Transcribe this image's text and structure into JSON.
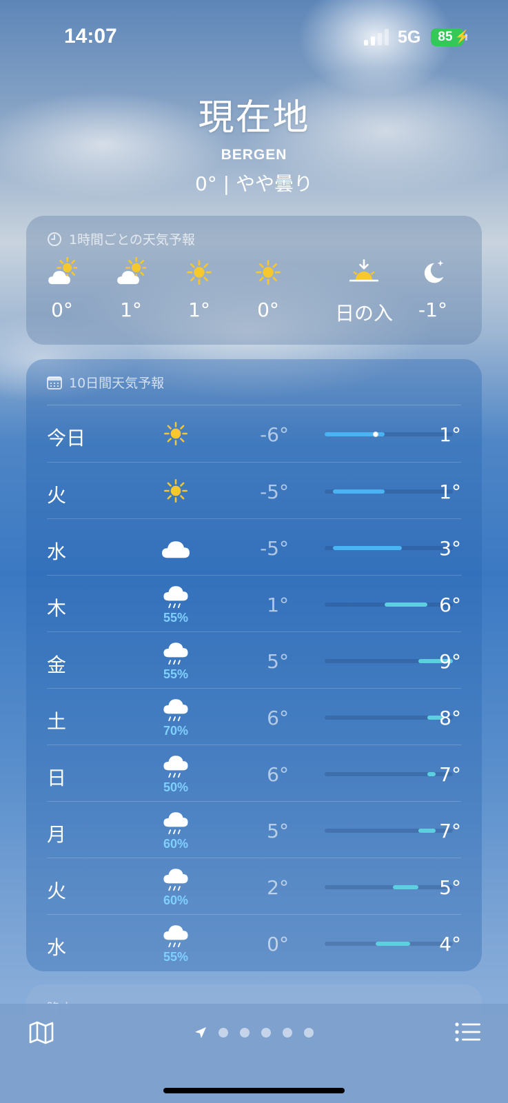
{
  "status_bar": {
    "time": "14:07",
    "network": "5G",
    "battery": "85"
  },
  "header": {
    "location": "現在地",
    "city": "BERGEN",
    "current": "0° | やや曇り"
  },
  "hourly": {
    "title": "1時間ごとの天気予報",
    "items": [
      {
        "icon": "partly-sunny-icon",
        "temp": "0°"
      },
      {
        "icon": "partly-sunny-icon",
        "temp": "1°"
      },
      {
        "icon": "sun-icon",
        "temp": "1°"
      },
      {
        "icon": "sun-icon",
        "temp": "0°"
      },
      {
        "icon": "sunset-icon",
        "temp": "日の入"
      },
      {
        "icon": "moon-stars-icon",
        "temp": "-1°"
      }
    ]
  },
  "daily": {
    "title": "10日間天気予報",
    "range_min": -6,
    "range_max": 9,
    "current_temp": 0,
    "colors": {
      "cold": "#4ab3f4",
      "mild": "#5dd0e0",
      "track": "#2e5a94"
    },
    "rows": [
      {
        "day": "今日",
        "icon": "sun-icon",
        "pct": "",
        "low": "-6°",
        "high": "1°",
        "low_val": -6,
        "high_val": 1,
        "now": true
      },
      {
        "day": "火",
        "icon": "sun-icon",
        "pct": "",
        "low": "-5°",
        "high": "1°",
        "low_val": -5,
        "high_val": 1
      },
      {
        "day": "水",
        "icon": "cloud-icon",
        "pct": "",
        "low": "-5°",
        "high": "3°",
        "low_val": -5,
        "high_val": 3
      },
      {
        "day": "木",
        "icon": "rain-icon",
        "pct": "55%",
        "low": "1°",
        "high": "6°",
        "low_val": 1,
        "high_val": 6
      },
      {
        "day": "金",
        "icon": "rain-icon",
        "pct": "55%",
        "low": "5°",
        "high": "9°",
        "low_val": 5,
        "high_val": 9
      },
      {
        "day": "土",
        "icon": "rain-icon",
        "pct": "70%",
        "low": "6°",
        "high": "8°",
        "low_val": 6,
        "high_val": 8
      },
      {
        "day": "日",
        "icon": "rain-icon",
        "pct": "50%",
        "low": "6°",
        "high": "7°",
        "low_val": 6,
        "high_val": 7
      },
      {
        "day": "月",
        "icon": "rain-icon",
        "pct": "60%",
        "low": "5°",
        "high": "7°",
        "low_val": 5,
        "high_val": 7
      },
      {
        "day": "火",
        "icon": "rain-icon",
        "pct": "60%",
        "low": "2°",
        "high": "5°",
        "low_val": 2,
        "high_val": 5
      },
      {
        "day": "水",
        "icon": "rain-icon",
        "pct": "55%",
        "low": "0°",
        "high": "4°",
        "low_val": 0,
        "high_val": 4
      }
    ]
  },
  "next_card": {
    "label": "降水"
  },
  "tabbar": {
    "map": "map-icon",
    "list": "list-icon",
    "page_count": 5
  }
}
